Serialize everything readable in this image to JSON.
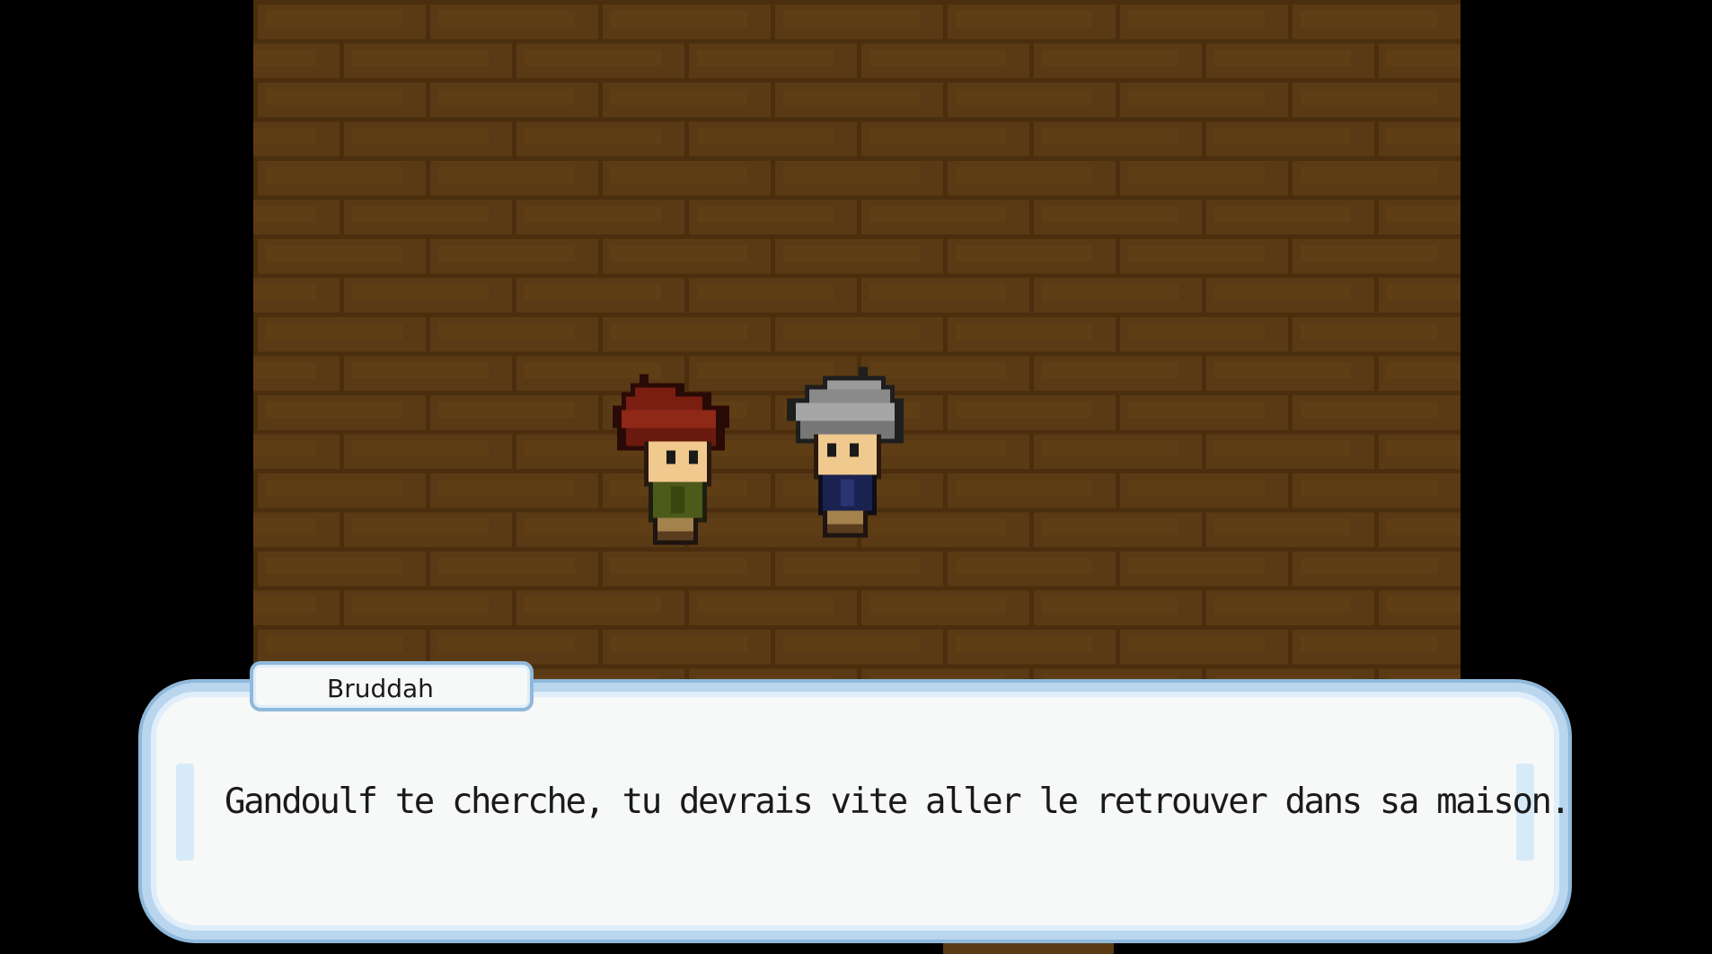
{
  "scene": {
    "floor_color": "#5a3a14",
    "brick_shadow_color": "#4a2e0e",
    "brick_highlight_color": "#6b4818"
  },
  "characters": [
    {
      "name": "red-haired-character",
      "hair_color": "#7a1e12",
      "clothes_color": "#4c5a1a"
    },
    {
      "name": "grey-haired-character",
      "hair_color": "#8a8a8a",
      "clothes_color": "#1a2250"
    }
  ],
  "dialogue": {
    "speaker": "Bruddah",
    "text": "Gandoulf te cherche, tu devrais vite aller le retrouver dans sa maison."
  },
  "colors": {
    "box_border": "#b9d6ee",
    "box_fill": "#f7f8f8",
    "text": "#1a1a1a"
  }
}
